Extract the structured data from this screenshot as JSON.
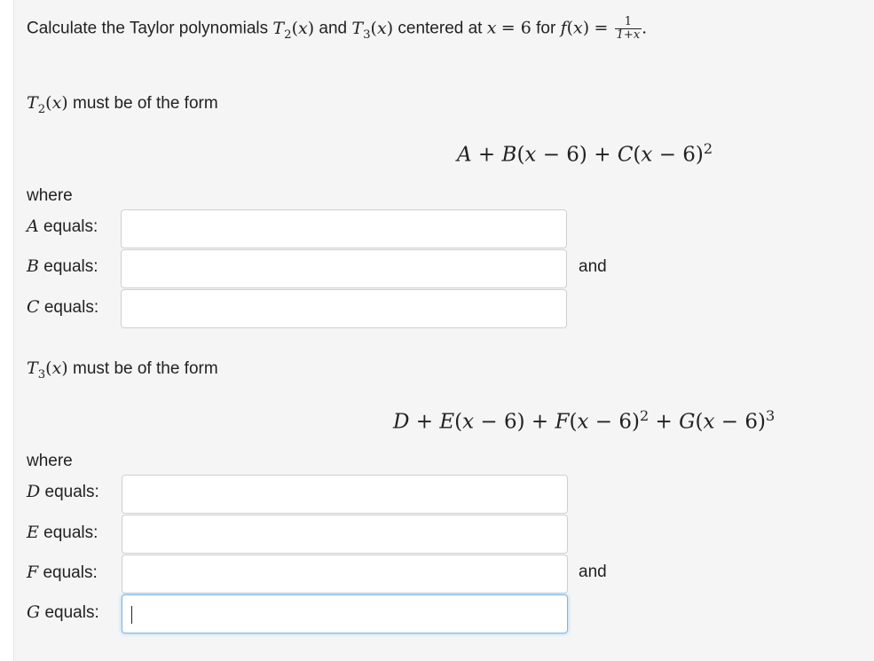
{
  "question": {
    "lead": "Calculate the Taylor polynomials",
    "and": "and",
    "centered_at": "centered at",
    "for": "for",
    "frac_num": "1",
    "frac_den": "1+x"
  },
  "t2_section": {
    "form_text": "must be of the form",
    "where": "where",
    "labels": [
      "equals:",
      "equals:",
      "equals:"
    ],
    "vars": [
      "A",
      "B",
      "C"
    ],
    "and_label": "and",
    "values": [
      "",
      "",
      ""
    ]
  },
  "t3_section": {
    "form_text": "must be of the form",
    "where": "where",
    "labels": [
      "equals:",
      "equals:",
      "equals:",
      "equals:"
    ],
    "vars": [
      "D",
      "E",
      "F",
      "G"
    ],
    "and_label": "and",
    "values": [
      "",
      "",
      "",
      ""
    ]
  }
}
